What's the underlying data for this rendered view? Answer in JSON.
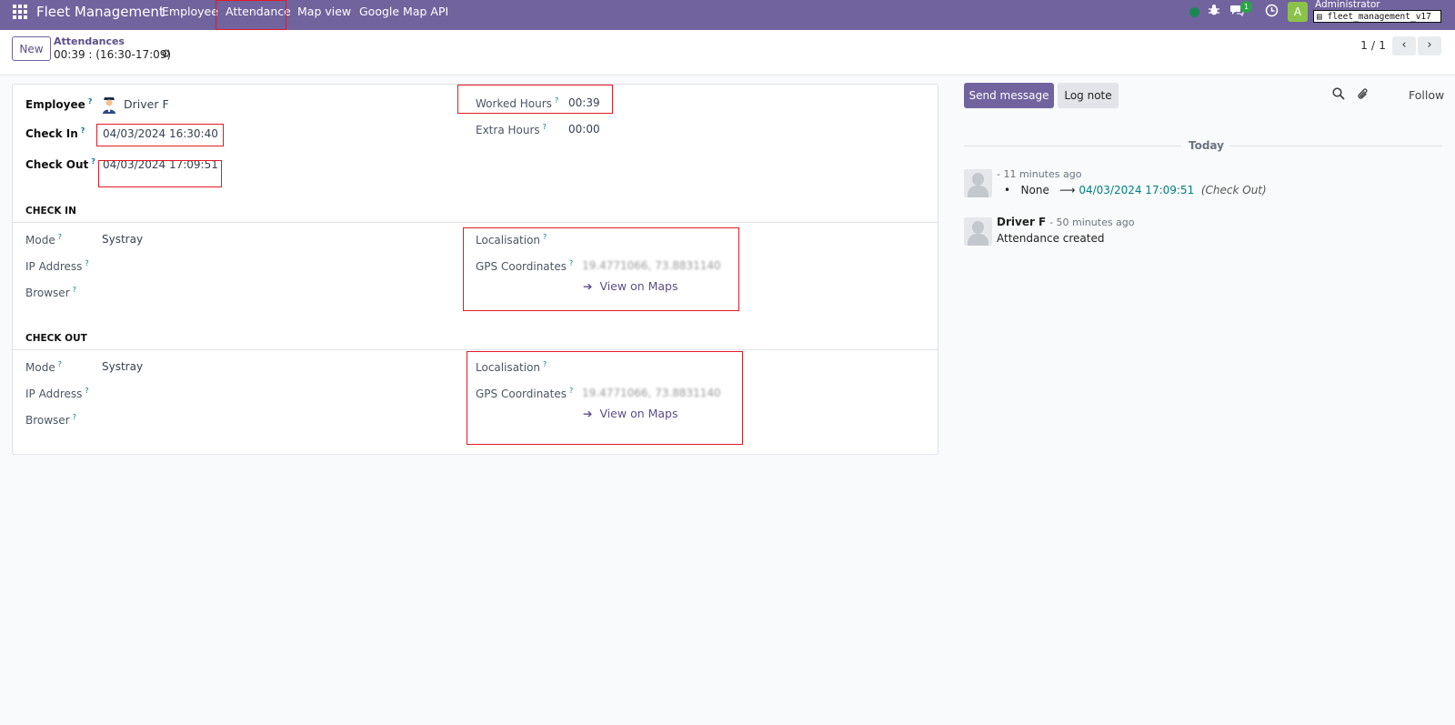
{
  "navbar": {
    "brand": "Fleet Management",
    "menu": [
      "Employee",
      "Attendance",
      "Map view",
      "Google Map API"
    ],
    "message_count": "1",
    "avatar_letter": "A",
    "user_name": "Administrator",
    "database": "fleet_management_v17"
  },
  "control": {
    "new_label": "New",
    "breadcrumb_parent": "Attendances",
    "breadcrumb_current": "00:39 : (16:30-17:09)",
    "pager": "1 / 1"
  },
  "form": {
    "employee_label": "Employee",
    "employee_value": "Driver F",
    "check_in_label": "Check In",
    "check_in_value": "04/03/2024 16:30:40",
    "check_out_label": "Check Out",
    "check_out_value": "04/03/2024 17:09:51",
    "worked_hours_label": "Worked Hours",
    "worked_hours_value": "00:39",
    "extra_hours_label": "Extra Hours",
    "extra_hours_value": "00:00",
    "check_in_section": {
      "title": "CHECK IN",
      "mode_label": "Mode",
      "mode_value": "Systray",
      "ip_label": "IP Address",
      "browser_label": "Browser",
      "localisation_label": "Localisation",
      "gps_label": "GPS Coordinates",
      "gps_value": "19.4771066, 73.8831140",
      "maps_link": "View on Maps"
    },
    "check_out_section": {
      "title": "CHECK OUT",
      "mode_label": "Mode",
      "mode_value": "Systray",
      "ip_label": "IP Address",
      "browser_label": "Browser",
      "localisation_label": "Localisation",
      "gps_label": "GPS Coordinates",
      "gps_value": "19.4771066, 73.8831140",
      "maps_link": "View on Maps"
    }
  },
  "chatter": {
    "send_message": "Send message",
    "log_note": "Log note",
    "follow": "Follow",
    "date_separator": "Today",
    "messages": [
      {
        "author": "",
        "time": "- 11 minutes ago",
        "old_value": "None",
        "arrow": "⟶",
        "new_value": "04/03/2024 17:09:51",
        "field": "(Check Out)"
      },
      {
        "author": "Driver F",
        "time": "- 50 minutes ago",
        "body": "Attendance created"
      }
    ]
  },
  "colors": {
    "navbar": "#71639e",
    "highlight_box": "#e01b24",
    "link_teal": "#017e84",
    "status_online": "#198754"
  }
}
